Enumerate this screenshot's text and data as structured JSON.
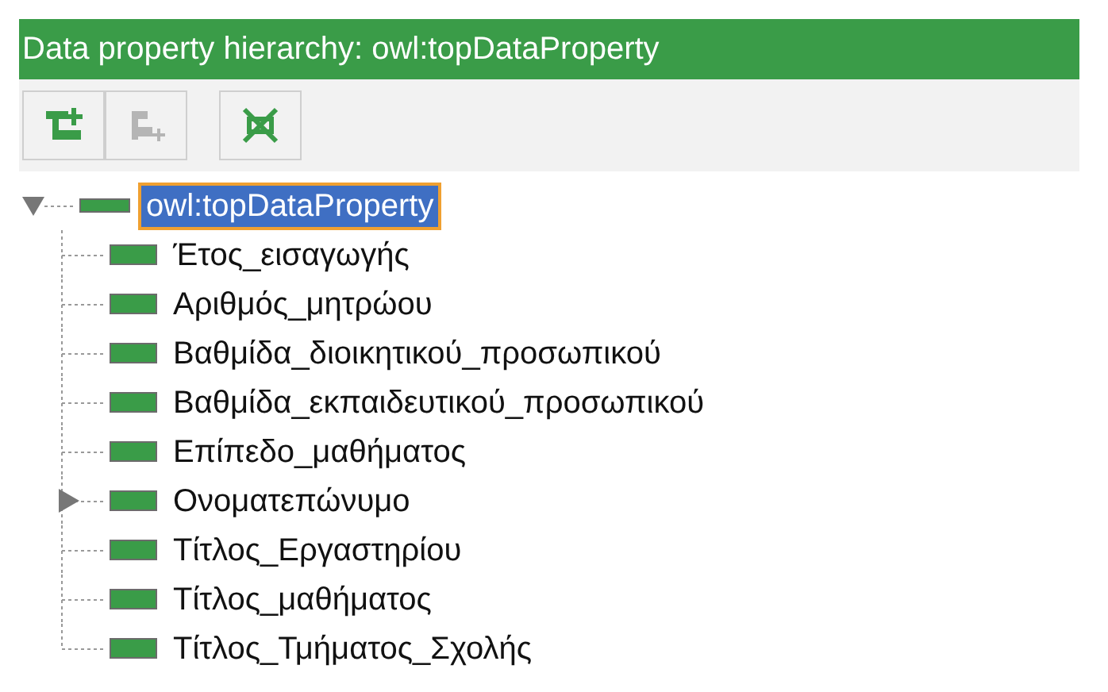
{
  "header": {
    "title": "Data property hierarchy: owl:topDataProperty"
  },
  "toolbar": [
    {
      "kind": "add-sub",
      "disabled": false
    },
    {
      "kind": "add-sibling",
      "disabled": true
    },
    {
      "kind": "delete",
      "disabled": false
    }
  ],
  "tree": [
    {
      "label": "owl:topDataProperty",
      "selected": true,
      "expanded": true,
      "children": [
        {
          "label": "Έτος_εισαγωγής",
          "selected": false
        },
        {
          "label": "Αριθμός_μητρώου",
          "selected": false
        },
        {
          "label": "Βαθμίδα_διοικητικού_προσωπικού",
          "selected": false
        },
        {
          "label": "Βαθμίδα_εκπαιδευτικού_προσωπικού",
          "selected": false
        },
        {
          "label": "Επίπεδο_μαθήματος",
          "selected": false
        },
        {
          "label": "Ονοματεπώνυμο",
          "selected": false,
          "expanded": false
        },
        {
          "label": "Τίτλος_Εργαστηρίου",
          "selected": false
        },
        {
          "label": "Τίτλος_μαθήματος",
          "selected": false
        },
        {
          "label": "Τίτλος_Τμήματος_Σχολής",
          "selected": false
        }
      ]
    }
  ]
}
